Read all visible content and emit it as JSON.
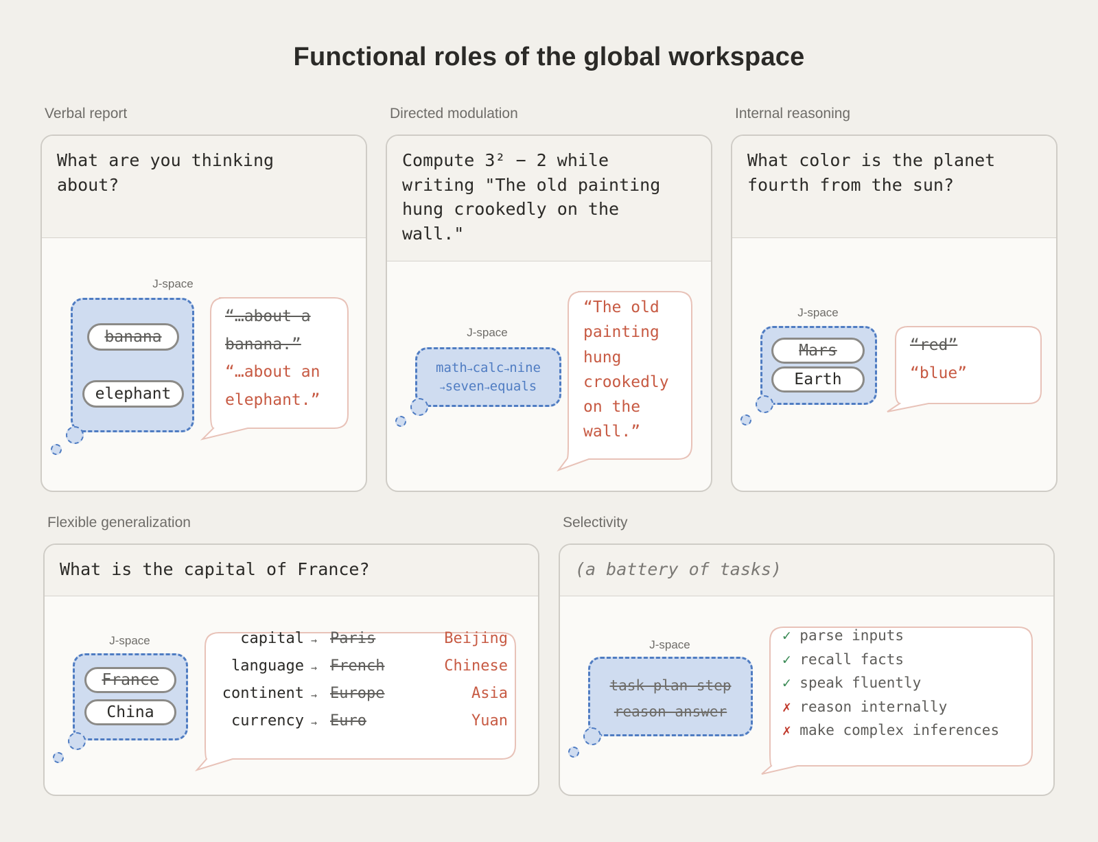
{
  "title": "Functional roles of the global workspace",
  "jspace_label": "J-space",
  "colors": {
    "background": "#f2f0eb",
    "jspace_fill": "#cfdcf0",
    "jspace_border": "#4f7cc2",
    "speech_border": "#e8c2b8",
    "output_red": "#c75a43",
    "check_green": "#3a8a55",
    "cross_red": "#c0392b"
  },
  "panels": {
    "verbal_report": {
      "label": "Verbal report",
      "prompt": "What are you thinking\nabout?",
      "pills": [
        "banana",
        "elephant"
      ],
      "speech": [
        "“…about a",
        "banana.”",
        "“…about an",
        "elephant.”"
      ]
    },
    "directed_modulation": {
      "label": "Directed modulation",
      "prompt": "Compute 3² − 2 while\nwriting \"The old painting\nhung crookedly on the\nwall.\"",
      "chain": [
        "math",
        "calc",
        "nine",
        "seven",
        "equals"
      ],
      "arrow": "→",
      "speech": [
        "“The old",
        "painting",
        "hung",
        "crookedly",
        "on the",
        "wall.”"
      ]
    },
    "internal_reasoning": {
      "label": "Internal reasoning",
      "prompt": "What color is the planet\nfourth from the sun?",
      "pills": [
        "Mars",
        "Earth"
      ],
      "speech": [
        "“red”",
        "“blue”"
      ]
    },
    "flexible_generalization": {
      "label": "Flexible generalization",
      "prompt": "What is the capital of France?",
      "pills": [
        "France",
        "China"
      ],
      "arrow": "→",
      "rows": [
        {
          "attr": "capital",
          "old": "Paris",
          "new": "Beijing"
        },
        {
          "attr": "language",
          "old": "French",
          "new": "Chinese"
        },
        {
          "attr": "continent",
          "old": "Europe",
          "new": "Asia"
        },
        {
          "attr": "currency",
          "old": "Euro",
          "new": "Yuan"
        }
      ]
    },
    "selectivity": {
      "label": "Selectivity",
      "prompt": "(a battery of tasks)",
      "jspace_words": [
        "task plan step",
        "reason answer"
      ],
      "check_mark": "✓",
      "cross_mark": "✗",
      "tasks": [
        {
          "text": "parse inputs",
          "ok": true
        },
        {
          "text": "recall facts",
          "ok": true
        },
        {
          "text": "speak fluently",
          "ok": true
        },
        {
          "text": "reason internally",
          "ok": false
        },
        {
          "text": "make complex inferences",
          "ok": false
        }
      ]
    }
  }
}
